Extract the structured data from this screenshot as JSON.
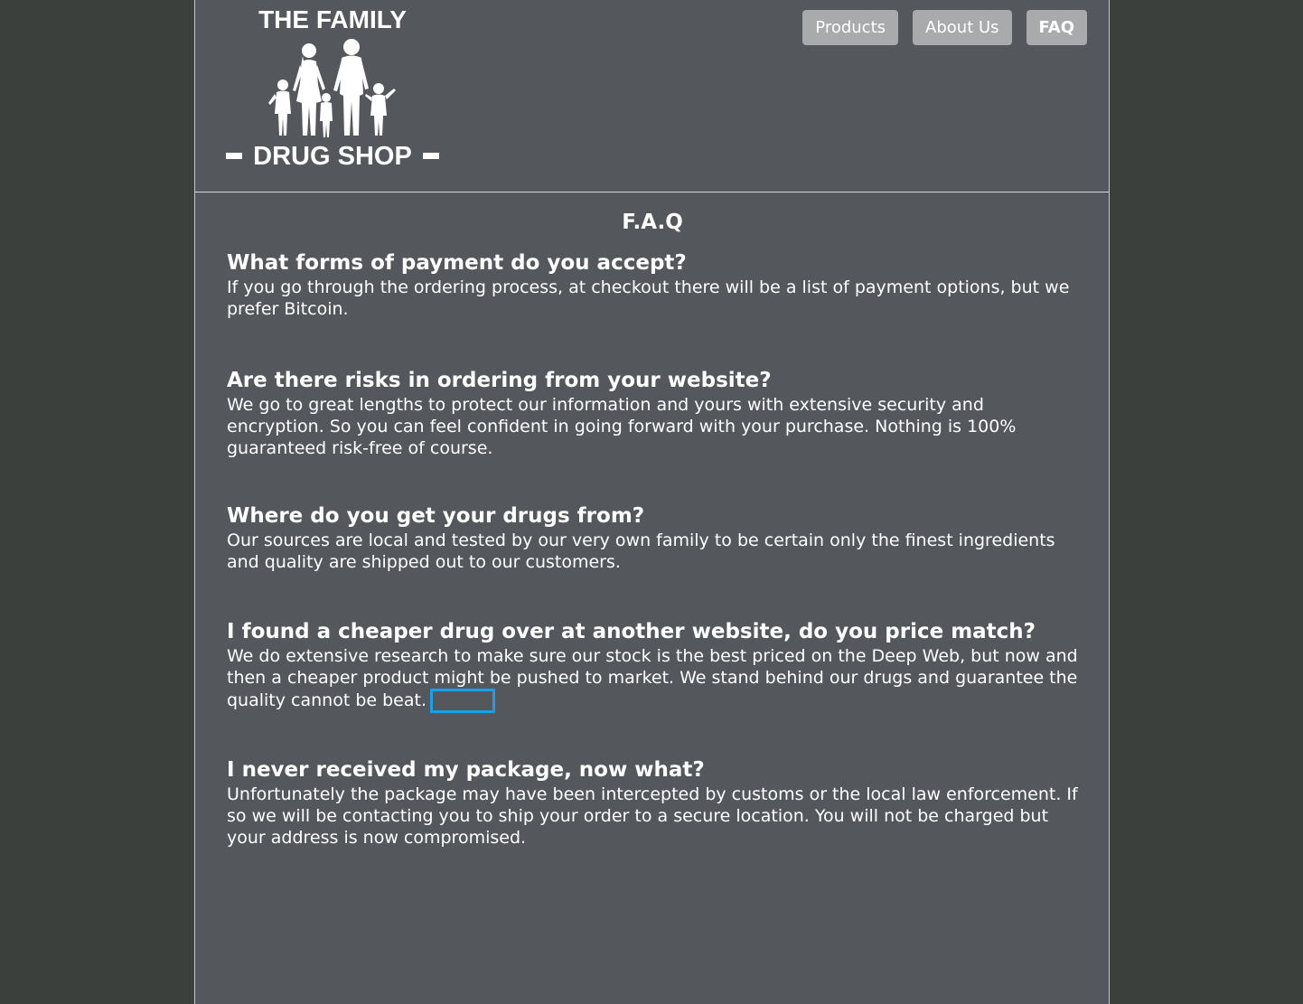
{
  "logo": {
    "top_text": "THE FAMILY",
    "bottom_text": "DRUG SHOP"
  },
  "nav": {
    "items": [
      {
        "label": "Products",
        "active": false
      },
      {
        "label": "About Us",
        "active": false
      },
      {
        "label": "FAQ",
        "active": true
      }
    ]
  },
  "faq": {
    "title": "F.A.Q",
    "items": [
      {
        "question": "What forms of payment do you accept?",
        "answer": "If you go through the ordering process, at checkout there will be a list of payment options, but we prefer Bitcoin."
      },
      {
        "question": "Are there risks in ordering from your website?",
        "answer": "We go to great lengths to protect our information and yours with extensive security and encryption. So you can feel confident in going forward with your purchase. Nothing is 100% guaranteed risk-free of course."
      },
      {
        "question": "Where do you get your drugs from?",
        "answer": "Our sources are local and tested by our very own family to be certain only the finest ingredients and quality are shipped out to our customers."
      },
      {
        "question": "I found a cheaper drug over at another website, do you price match?",
        "answer": "We do extensive research to make sure our stock is the best priced on the Deep Web, but now and then a cheaper product might be pushed to market. We stand behind our drugs and guarantee the quality cannot be beat."
      },
      {
        "question": "I never received my package, now what?",
        "answer": "Unfortunately the package may have been intercepted by customs or the local law enforcement. If so we will be contacting you to ship your order to a secure location. You will not be charged but your address is now compromised."
      }
    ]
  },
  "colors": {
    "background": "#3c403d",
    "panel": "#54575b",
    "nav_button": "#a9aaac",
    "focus_outline": "#1aa0e6"
  },
  "icons": {
    "logo_graphic": "family-silhouette-icon"
  }
}
